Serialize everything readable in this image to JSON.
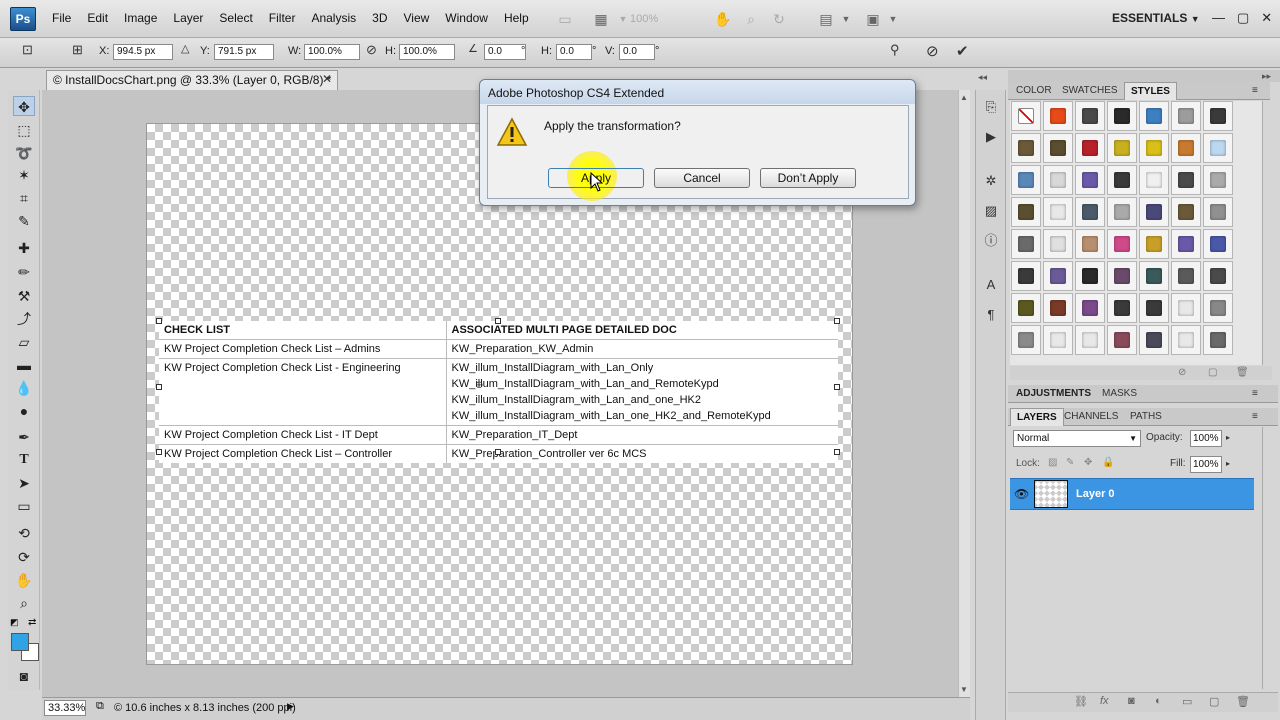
{
  "app": {
    "logo": "Ps"
  },
  "menubar": {
    "items": [
      "File",
      "Edit",
      "Image",
      "Layer",
      "Select",
      "Filter",
      "Analysis",
      "3D",
      "View",
      "Window",
      "Help"
    ],
    "zoom": "100%",
    "workspace": "ESSENTIALS"
  },
  "options": {
    "x_label": "X:",
    "x_value": "994.5 px",
    "y_label": "Y:",
    "y_value": "791.5 px",
    "w_label": "W:",
    "w_value": "100.0%",
    "h_label": "H:",
    "h_value": "100.0%",
    "angle_value": "0.0",
    "angle_unit": "°",
    "hskew_label": "H:",
    "hskew_value": "0.0",
    "vskew_label": "V:",
    "vskew_value": "0.0"
  },
  "document": {
    "tab_title": "© InstallDocsChart.png @ 33.3% (Layer 0, RGB/8) *",
    "table": {
      "headers": [
        "CHECK LIST",
        "ASSOCIATED MULTI PAGE DETAILED DOC"
      ],
      "rows": [
        [
          "KW Project Completion Check List – Admins",
          "KW_Preparation_KW_Admin"
        ],
        [
          "KW Project Completion Check List - Engineering",
          "KW_illum_InstallDiagram_with_Lan_Only\nKW_illum_InstallDiagram_with_Lan_and_RemoteKypd\nKW_illum_InstallDiagram_with_Lan_and_one_HK2\nKW_illum_InstallDiagram_with_Lan_one_HK2_and_RemoteKypd"
        ],
        [
          "KW Project Completion Check List - IT Dept",
          "KW_Preparation_IT_Dept"
        ],
        [
          "KW Project Completion Check List – Controller",
          "KW_Preparation_Controller ver 6c MCS"
        ]
      ]
    }
  },
  "status": {
    "zoom": "33.33%",
    "info": "10.6 inches x 8.13 inches (200 ppi)"
  },
  "dialog": {
    "title": "Adobe Photoshop CS4 Extended",
    "message": "Apply the transformation?",
    "apply_label": "Apply",
    "cancel_label": "Cancel",
    "dont_apply_label": "Don’t Apply"
  },
  "styles_panel": {
    "tabs": [
      "COLOR",
      "SWATCHES",
      "STYLES"
    ],
    "active_tab": "STYLES",
    "swatch_colors": [
      "#ffffff",
      "#e84a18",
      "#4a4a4a",
      "#2a2a2a",
      "#3d7fc0",
      "#9c9c9c",
      "#3a3a3a",
      "#6b5a3a",
      "#5a4e2e",
      "#b8202a",
      "#c8b020",
      "#d8c018",
      "#c87a30",
      "#bcd8f0",
      "#5a88b8",
      "#d8d8d8",
      "#6a5aa8",
      "#3a3a3a",
      "#f0f0f0",
      "#4a4a4a",
      "#aaaaaa",
      "#5a5030",
      "#e8e8e8",
      "#4a5a6a",
      "#aaaaaa",
      "#4a4a7a",
      "#6a5a3a",
      "#909090",
      "#6a6a6a",
      "#e0e0e0",
      "#b89070",
      "#d04a8a",
      "#c8a028",
      "#6a58a8",
      "#4a58a8",
      "#3a3a3a",
      "#6a5a98",
      "#2a2a2a",
      "#6a4a6a",
      "#3a5a5a",
      "#5a5a5a",
      "#4a4a4a",
      "#5a5a20",
      "#7a3a28",
      "#7a4a8a",
      "#3a3a3a",
      "#3a3a3a",
      "#e8e8e8",
      "#888888",
      "#8a8a8a",
      "#e8e8e8",
      "#e8e8e8",
      "#8a4a5a",
      "#4a4a5a",
      "#e8e8e8",
      "#6a6a6a"
    ]
  },
  "adjustments_panel": {
    "tabs": [
      "ADJUSTMENTS",
      "MASKS"
    ]
  },
  "layers_panel": {
    "tabs": [
      "LAYERS",
      "CHANNELS",
      "PATHS"
    ],
    "blend_mode": "Normal",
    "opacity_label": "Opacity:",
    "opacity_value": "100%",
    "lock_label": "Lock:",
    "fill_label": "Fill:",
    "fill_value": "100%",
    "layer_name": "Layer 0"
  },
  "colors": {
    "accent": "#3b95e3",
    "foreground": "#2fa3e6",
    "highlight": "#ffeb00"
  }
}
